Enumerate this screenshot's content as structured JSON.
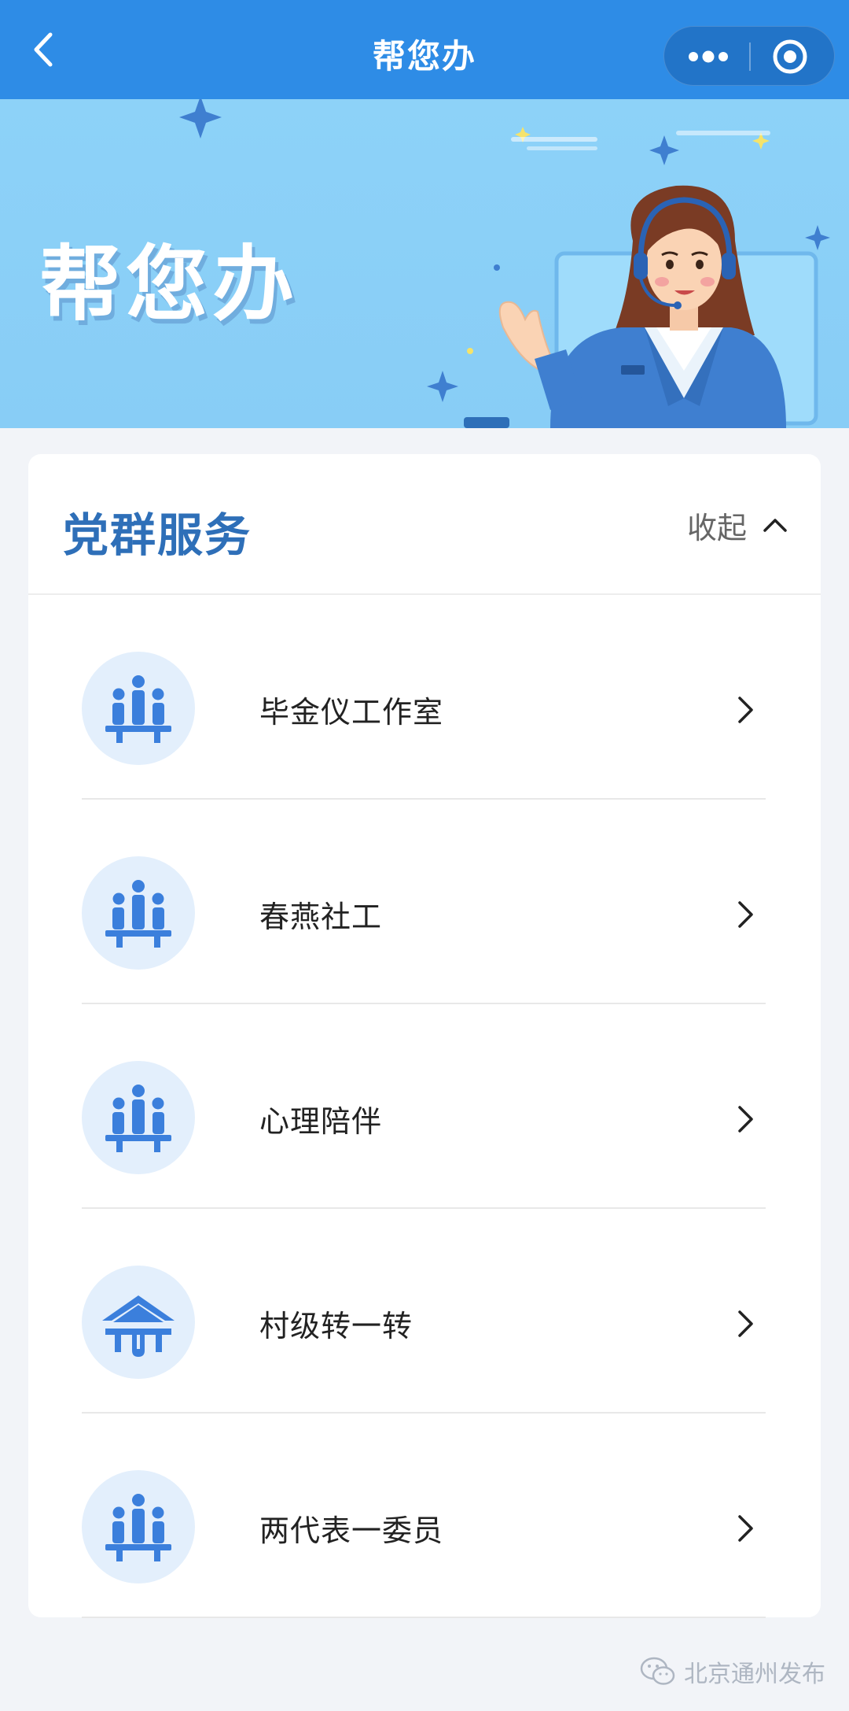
{
  "navbar": {
    "title": "帮您办",
    "back_icon": "chevron-left-icon",
    "more_icon": "more-dots-icon",
    "close_icon": "target-close-icon"
  },
  "banner": {
    "title": "帮您办"
  },
  "section": {
    "title": "党群服务",
    "collapse_label": "收起"
  },
  "items": [
    {
      "label": "毕金仪工作室",
      "icon": "people-group-icon"
    },
    {
      "label": "春燕社工",
      "icon": "people-group-icon"
    },
    {
      "label": "心理陪伴",
      "icon": "people-group-icon"
    },
    {
      "label": "村级转一转",
      "icon": "house-icon"
    },
    {
      "label": "两代表一委员",
      "icon": "people-group-icon"
    }
  ],
  "watermark": {
    "text": "北京通州发布",
    "icon": "wechat-icon"
  },
  "colors": {
    "navbar": "#2e8ce6",
    "accent": "#2e6fb8",
    "icon_blue": "#3b7fdc",
    "icon_bg": "#e3effc"
  }
}
